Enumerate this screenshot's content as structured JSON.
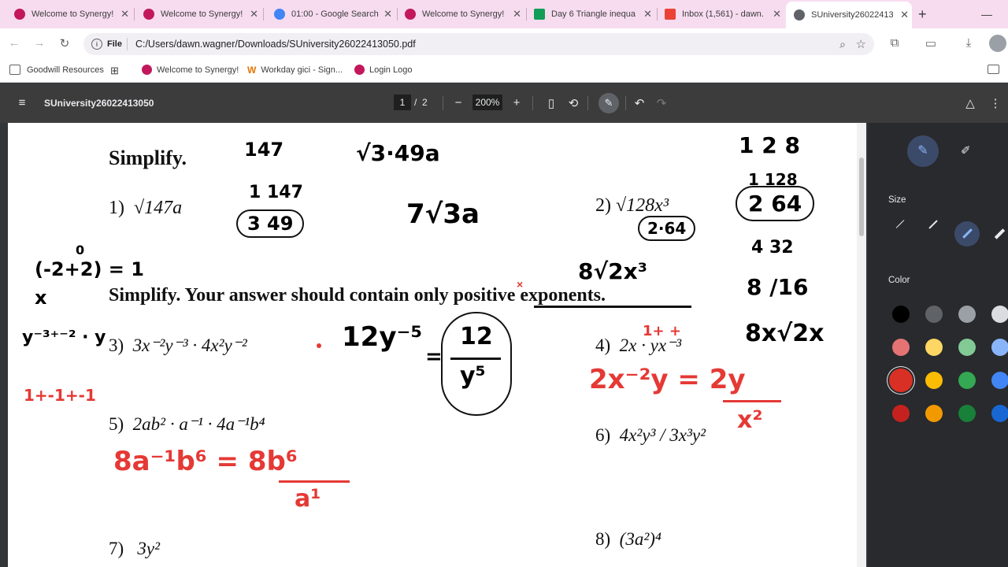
{
  "tabs": [
    {
      "title": "Welcome to Synergy!",
      "favicon_color": "#c2185b"
    },
    {
      "title": "Welcome to Synergy!",
      "favicon_color": "#c2185b"
    },
    {
      "title": "01:00 - Google Search",
      "favicon_color": "#4285f4"
    },
    {
      "title": "Welcome to Synergy!",
      "favicon_color": "#c2185b"
    },
    {
      "title": "Day 6 Triangle inequa",
      "favicon_color": "#0f9d58"
    },
    {
      "title": "Inbox (1,561) - dawn.",
      "favicon_color": "#ea4335"
    },
    {
      "title": "SUniversity26022413050",
      "favicon_color": "#5f6368"
    }
  ],
  "new_tab_glyph": "+",
  "close_glyph": "✕",
  "toolbar": {
    "back": "←",
    "forward": "→",
    "reload": "↻",
    "file_chip": "File",
    "url": "C:/Users/dawn.wagner/Downloads/SUniversity26022413050.pdf"
  },
  "bookmarks": [
    {
      "label": "Goodwill Resources"
    },
    {
      "label": ""
    },
    {
      "label": "Welcome to Synergy!"
    },
    {
      "label": "Workday gici - Sign..."
    },
    {
      "label": "Login Logo"
    }
  ],
  "pdf": {
    "filename": "SUniversity26022413050",
    "page_current": "1",
    "page_sep": "/",
    "page_total": "2",
    "zoom": "200%"
  },
  "worksheet": {
    "heading1": "Simplify.",
    "heading2": "Simplify.  Your answer should contain only positive exponents.",
    "problems": [
      {
        "num": "1)",
        "expr": "√147a"
      },
      {
        "num": "2)",
        "expr": "√128x³"
      },
      {
        "num": "3)",
        "expr": "3x⁻²y⁻³ · 4x²y⁻²"
      },
      {
        "num": "4)",
        "expr": "2x · yx⁻³"
      },
      {
        "num": "5)",
        "expr": "2ab² · a⁻¹ · 4a⁻¹b⁴"
      },
      {
        "num": "6)",
        "expr": "4x²y³ / 3x³y²"
      },
      {
        "num": "7)",
        "expr": "3y²"
      },
      {
        "num": "8)",
        "expr": "(3a²)⁴"
      }
    ]
  },
  "annotations": {
    "a147": "147",
    "root3_49a": "√3·49a",
    "one_147": "1  147",
    "three_49": "3  49",
    "seven_root": "7√3a",
    "zero": "0",
    "neg_exp": "(-2+2) = 1",
    "x_letter": "x",
    "y_exp": "y⁻³⁺⁻² · y",
    "twelve_y": "12y⁻⁵",
    "twelve_over": "12",
    "y5": "y⁵",
    "equals": "=",
    "n128": "1 2 8",
    "n1_128": "1  128",
    "n2_64": "2  64",
    "n4_32": "4  32",
    "circle64": "2·64",
    "eight_root": "8√2x³",
    "eight_16": "8 /16",
    "eight_x_root": "8x√2x",
    "red_exp": "1+ +",
    "red_2xy": "2x⁻²y = 2y",
    "red_x2": "x²",
    "red_left": "1+-1+-1",
    "red_8ab": "8a⁻¹b⁶ = 8b⁶",
    "red_a1": "a¹"
  },
  "side_panel": {
    "size_label": "Size",
    "color_label": "Color",
    "colors": [
      "#000000",
      "#5f6368",
      "#9aa0a6",
      "#dadce0",
      "#e57373",
      "#fdd663",
      "#81c995",
      "#8ab4f8",
      "#d93025",
      "#fbbc04",
      "#34a853",
      "#4285f4",
      "#c5221f",
      "#f29900",
      "#188038",
      "#1967d2"
    ]
  }
}
